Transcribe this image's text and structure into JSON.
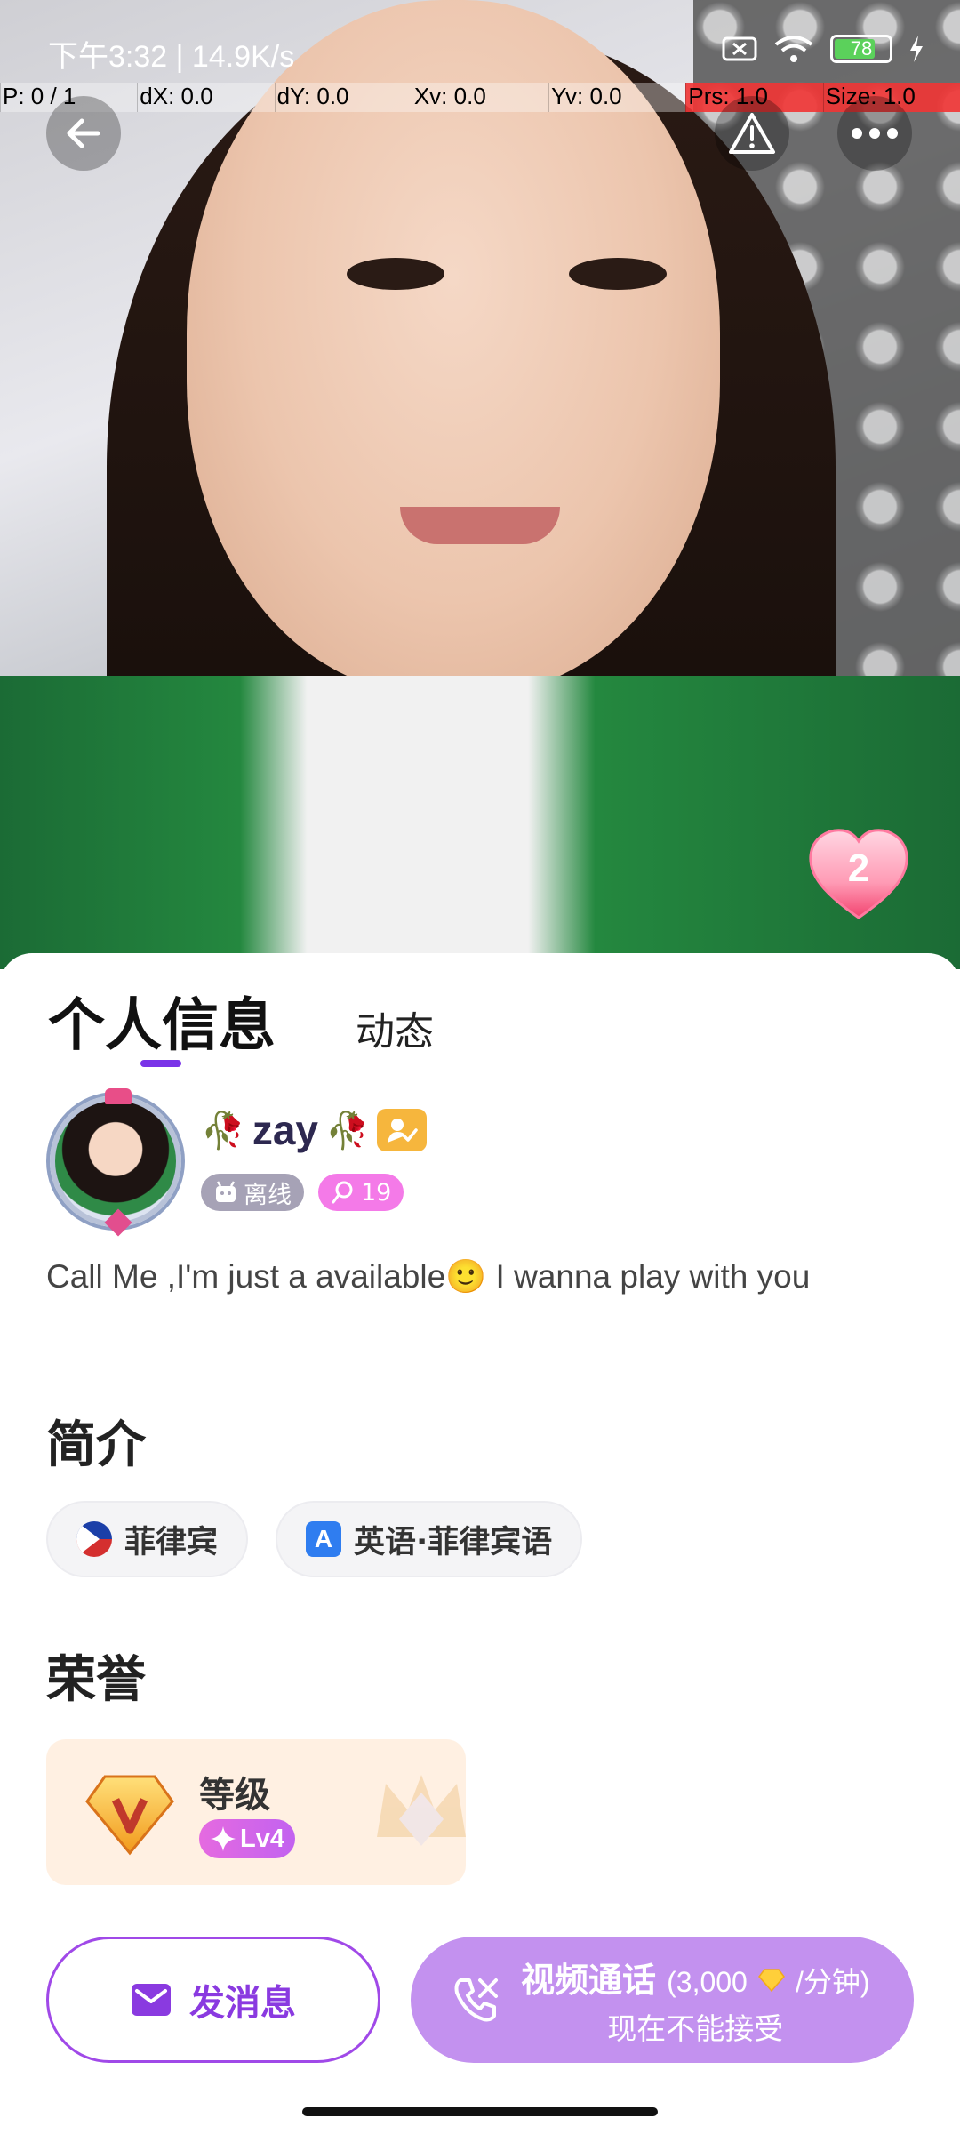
{
  "status_bar": {
    "time": "下午3:32 | 14.9K/s",
    "battery": "78"
  },
  "debug_bar": {
    "p": "P: 0 / 1",
    "dx": "dX: 0.0",
    "dy": "dY: 0.0",
    "xv": "Xv: 0.0",
    "yv": "Yv: 0.0",
    "prs": "Prs: 1.0",
    "size": "Size: 1.0"
  },
  "icons": {
    "back": "arrow-left-icon",
    "report": "warning-icon",
    "more": "more-icon",
    "heart": "heart-icon"
  },
  "heart_count": "2",
  "tabs": {
    "active": "个人信息",
    "other": "动态"
  },
  "profile": {
    "name": "zay",
    "status": "离线",
    "fans": "19",
    "bio": "Call Me ,I'm just a available🙂 I wanna play with you"
  },
  "intro": {
    "title": "简介",
    "country": "菲律宾",
    "languages": "英语·菲律宾语"
  },
  "honor": {
    "title": "荣誉",
    "level_label": "等级",
    "level_value": "Lv4"
  },
  "actions": {
    "message": "发消息",
    "call_title": "视频通话",
    "call_rate_prefix": "(3,000",
    "call_rate_suffix": "/分钟)",
    "call_sub": "现在不能接受"
  },
  "colors": {
    "accent": "#7a34e8",
    "call_button": "#c391ef",
    "fans_badge": "#f47ae8",
    "offline_badge": "#a6a2b6"
  }
}
